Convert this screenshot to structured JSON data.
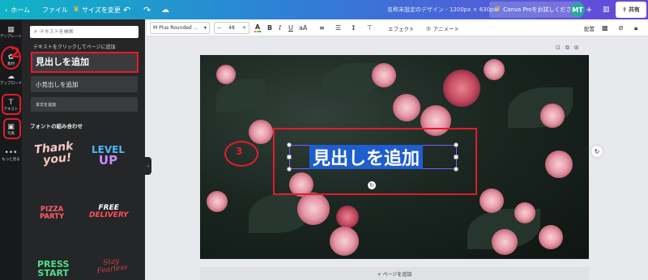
{
  "topbar": {
    "home_label": "ホーム",
    "file_label": "ファイル",
    "resize_label": "サイズを変更",
    "doc_title": "名称未設定のデザイン - 1200px × 630px",
    "pro_label": "Canva Proをお試しください",
    "avatar_initials": "MT",
    "share_label": "共有"
  },
  "rail": {
    "items": [
      {
        "icon": "template-icon",
        "label": "テンプレート"
      },
      {
        "icon": "elements-icon",
        "label": "素材"
      },
      {
        "icon": "upload-icon",
        "label": "アップロード"
      },
      {
        "icon": "text-icon",
        "label": "テキスト"
      },
      {
        "icon": "photo-icon",
        "label": "写真"
      },
      {
        "icon": "more-icon",
        "label": "もっと見る"
      }
    ]
  },
  "panel": {
    "search_placeholder": "テキストを検索",
    "hint": "テキストをクリックしてページに追加",
    "add_heading": "見出しを追加",
    "add_subheading": "小見出しを追加",
    "add_body": "本文を追加",
    "combos_title": "フォントの組み合わせ",
    "combos": {
      "thank_1": "Thank",
      "thank_2": "you!",
      "level_1": "LEVEL",
      "level_2": "UP",
      "pizza_1": "PIZZA",
      "pizza_2": "PARTY",
      "free_1": "FREE",
      "free_2": "DELIVERY",
      "press_1": "PRESS",
      "press_2": "START",
      "stay_1": "Stay",
      "stay_2": "Fearless"
    }
  },
  "toolbar": {
    "font_name": "M Plus Rounded ...",
    "font_size": "48",
    "effects_label": "エフェクト",
    "animate_label": "アニメート",
    "layout_label": "配置"
  },
  "canvas": {
    "heading_text": "見出しを追加",
    "add_page_label": "+ ページを追加"
  },
  "annotations": {
    "num_2": "2",
    "num_3": "3",
    "color": "#e31c2a"
  },
  "colors": {
    "topbar_start": "#0fb4c7",
    "topbar_end": "#6a45d8",
    "selection": "#1e5ecf"
  }
}
